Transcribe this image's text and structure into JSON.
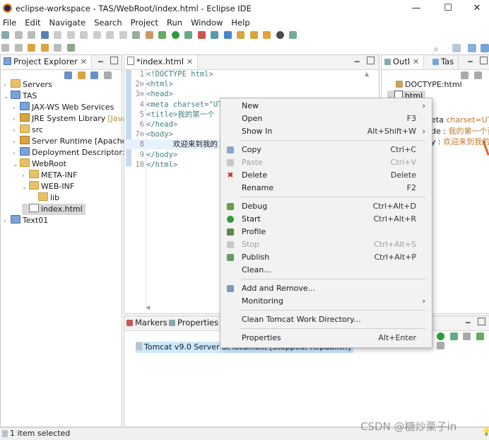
{
  "window": {
    "title": "eclipse-workspace - TAS/WebRoot/index.html - Eclipse IDE",
    "minimize": "—",
    "maximize": "☐",
    "close": "✕"
  },
  "menubar": [
    "File",
    "Edit",
    "Navigate",
    "Search",
    "Project",
    "Run",
    "Window",
    "Help"
  ],
  "project_explorer": {
    "tab_label": "Project Explorer",
    "items": [
      {
        "label": "Servers",
        "indent": 0,
        "arrow": "›",
        "icon": "folder"
      },
      {
        "label": "TAS",
        "indent": 0,
        "arrow": "⌄",
        "icon": "proj"
      },
      {
        "label": "JAX-WS Web Services",
        "indent": 1,
        "arrow": "›",
        "icon": "proj"
      },
      {
        "label": "JRE System Library",
        "indent": 1,
        "arrow": "›",
        "icon": "lib",
        "suffix": "[JavaSE"
      },
      {
        "label": "src",
        "indent": 1,
        "arrow": "›",
        "icon": "folder"
      },
      {
        "label": "Server Runtime [Apache",
        "indent": 1,
        "arrow": "›",
        "icon": "lib"
      },
      {
        "label": "Deployment Descriptor:",
        "indent": 1,
        "arrow": "›",
        "icon": "proj"
      },
      {
        "label": "WebRoot",
        "indent": 1,
        "arrow": "⌄",
        "icon": "folder"
      },
      {
        "label": "META-INF",
        "indent": 2,
        "arrow": "›",
        "icon": "folder"
      },
      {
        "label": "WEB-INF",
        "indent": 2,
        "arrow": "⌄",
        "icon": "folder"
      },
      {
        "label": "lib",
        "indent": 3,
        "arrow": "",
        "icon": "folder"
      },
      {
        "label": "index.html",
        "indent": 2,
        "arrow": "",
        "icon": "file",
        "selected": true
      },
      {
        "label": "Text01",
        "indent": 0,
        "arrow": "›",
        "icon": "proj"
      }
    ]
  },
  "editor": {
    "tab_label": "*index.html",
    "lines": [
      {
        "n": "1",
        "text": "<!DOCTYPE html>"
      },
      {
        "n": "2⊖",
        "text": "<html>"
      },
      {
        "n": "3⊖",
        "text": "<head>"
      },
      {
        "n": "4",
        "text": "<meta charset=\"UT"
      },
      {
        "n": "5",
        "text": "<title>我的第一个"
      },
      {
        "n": "6",
        "text": "</head>"
      },
      {
        "n": "7⊖",
        "text": "<body>"
      },
      {
        "n": "8",
        "text": "      欢迎来到我的"
      },
      {
        "n": "9",
        "text": "</body>"
      },
      {
        "n": "10",
        "text": "</html>"
      }
    ]
  },
  "outline": {
    "tab_label": "Outl",
    "tab2_label": "Tas",
    "items": [
      "DOCTYPE:html",
      "html"
    ],
    "snippets": [
      {
        "a": "eta ",
        "b": "charset=UTF"
      },
      {
        "a": "de : ",
        "b": "我的第一个页"
      },
      {
        "a": "y : ",
        "b": "欢迎来到我的第"
      }
    ]
  },
  "bottom": {
    "tab_markers": "Markers",
    "tab_properties": "Properties",
    "server_entry": "Tomcat v9.0 Server at localhost  [Stopped, Republish]"
  },
  "context_menu": [
    {
      "label": "New",
      "shortcut": "",
      "submenu": true
    },
    {
      "label": "Open",
      "shortcut": "F3"
    },
    {
      "label": "Show In",
      "shortcut": "Alt+Shift+W",
      "submenu": true
    },
    {
      "sep": true
    },
    {
      "label": "Copy",
      "shortcut": "Ctrl+C",
      "icon": "copy"
    },
    {
      "label": "Paste",
      "shortcut": "Ctrl+V",
      "icon": "paste",
      "disabled": true
    },
    {
      "label": "Delete",
      "shortcut": "Delete",
      "icon": "delete"
    },
    {
      "label": "Rename",
      "shortcut": "F2"
    },
    {
      "sep": true
    },
    {
      "label": "Debug",
      "shortcut": "Ctrl+Alt+D",
      "icon": "debug"
    },
    {
      "label": "Start",
      "shortcut": "Ctrl+Alt+R",
      "icon": "start"
    },
    {
      "label": "Profile",
      "shortcut": "",
      "icon": "profile"
    },
    {
      "label": "Stop",
      "shortcut": "Ctrl+Alt+S",
      "icon": "stop",
      "disabled": true
    },
    {
      "label": "Publish",
      "shortcut": "Ctrl+Alt+P",
      "icon": "publish"
    },
    {
      "label": "Clean...",
      "shortcut": ""
    },
    {
      "sep": true
    },
    {
      "label": "Add and Remove...",
      "shortcut": "",
      "icon": "addremove"
    },
    {
      "label": "Monitoring",
      "shortcut": "",
      "submenu": true
    },
    {
      "sep": true
    },
    {
      "label": "Clean Tomcat Work Directory...",
      "shortcut": ""
    },
    {
      "sep": true
    },
    {
      "label": "Properties",
      "shortcut": "Alt+Enter"
    }
  ],
  "status": {
    "text": "1 item selected"
  },
  "watermark": "CSDN @糖炒栗子in",
  "colors": {
    "selection": "#cde8ff",
    "accent": "#0078d7",
    "delete_red": "#d9281e",
    "start_green": "#2e9a3a"
  }
}
